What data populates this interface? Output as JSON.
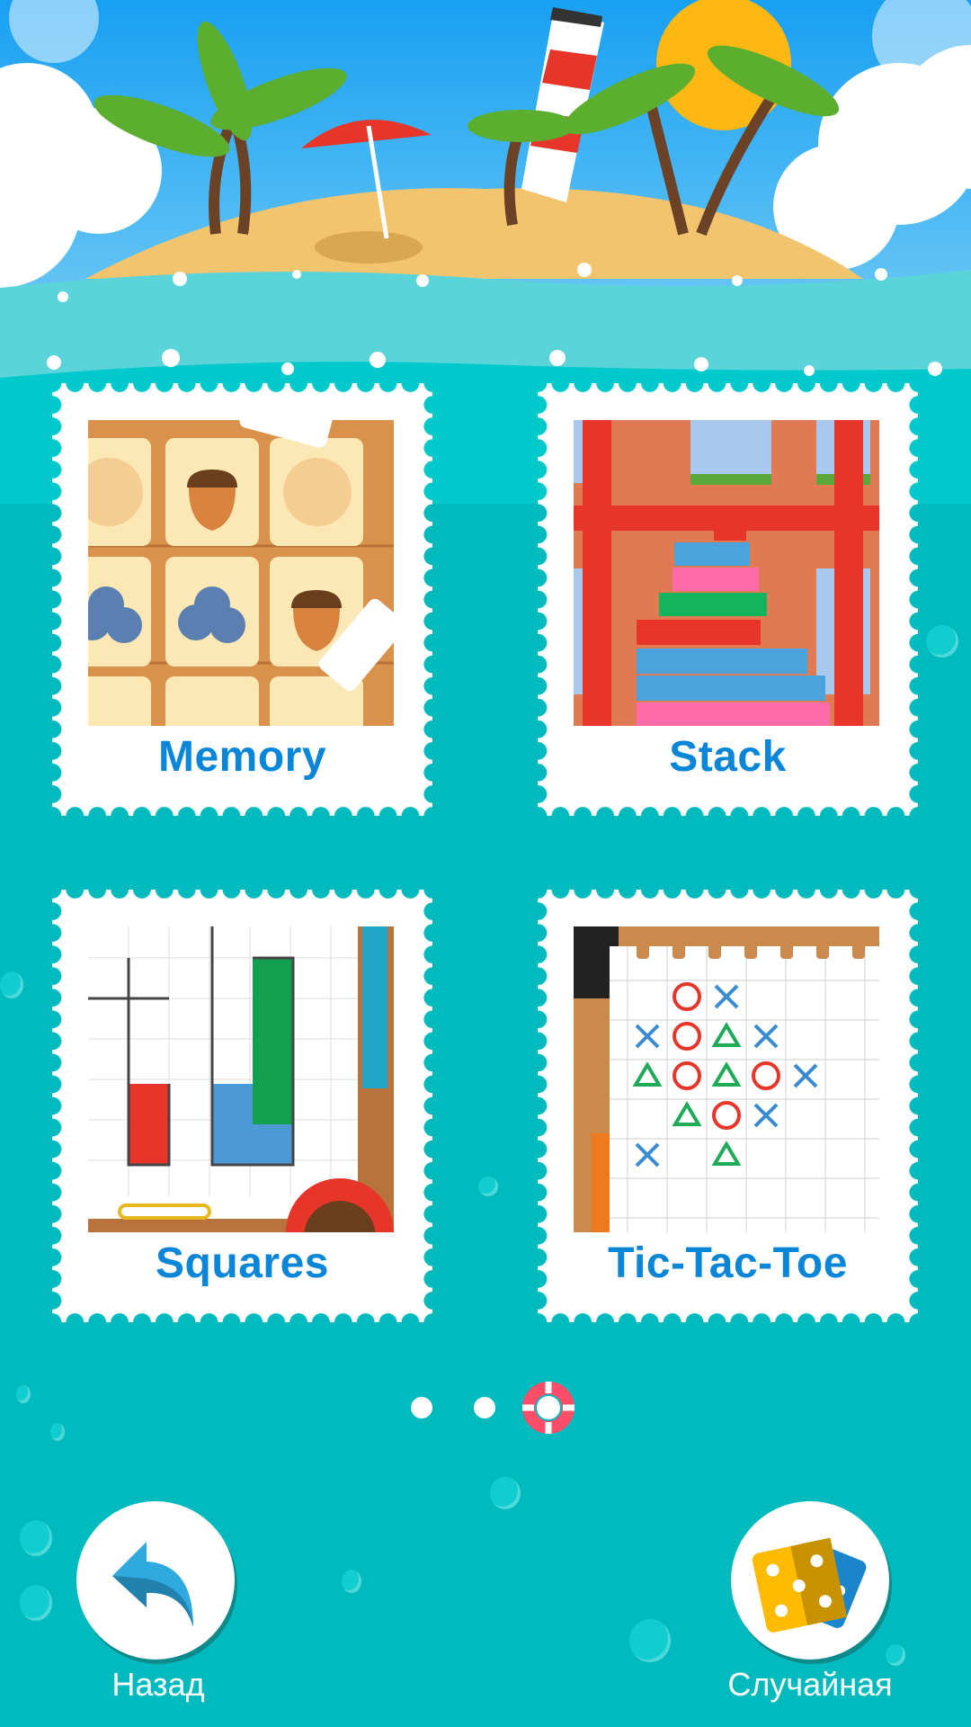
{
  "header": {
    "scene": "tropical-island-banner"
  },
  "games": [
    {
      "label": "Memory",
      "thumbnail": "memory-cards"
    },
    {
      "label": "Stack",
      "thumbnail": "stack-tower"
    },
    {
      "label": "Squares",
      "thumbnail": "dots-and-boxes"
    },
    {
      "label": "Tic-Tac-Toe",
      "thumbnail": "tic-tac-toe-grid"
    }
  ],
  "pagination": {
    "pages": 3,
    "current": 3,
    "current_icon": "lifebuoy-icon"
  },
  "buttons": {
    "back_label": "Назад",
    "random_label": "Случайная"
  },
  "colors": {
    "background": "#00babd",
    "label": "#0a86d8",
    "sky": "#2aa8f0"
  }
}
